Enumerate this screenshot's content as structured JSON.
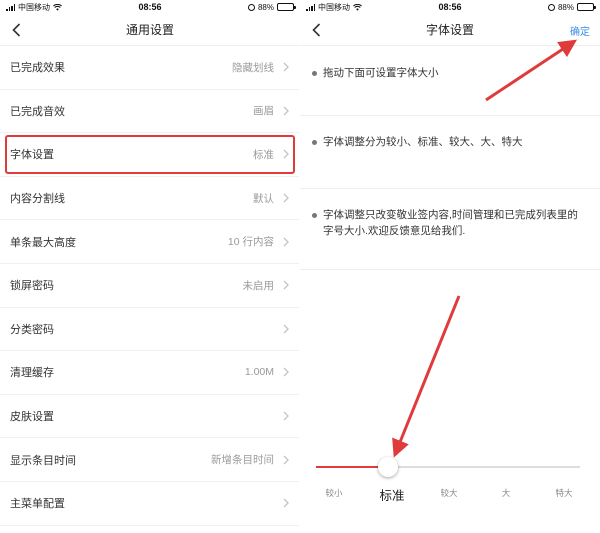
{
  "status_bar": {
    "carrier": "中国移动",
    "time": "08:56",
    "battery": "88%",
    "battery_level": 0.88
  },
  "left_screen": {
    "title": "通用设置",
    "rows": [
      {
        "label": "已完成效果",
        "value": "隐藏划线"
      },
      {
        "label": "已完成音效",
        "value": "画眉"
      },
      {
        "label": "字体设置",
        "value": "标准",
        "highlight": true
      },
      {
        "label": "内容分割线",
        "value": "默认"
      },
      {
        "label": "单条最大高度",
        "value": "10 行内容"
      },
      {
        "label": "锁屏密码",
        "value": "未启用"
      },
      {
        "label": "分类密码",
        "value": ""
      },
      {
        "label": "清理缓存",
        "value": "1.00M"
      },
      {
        "label": "皮肤设置",
        "value": ""
      },
      {
        "label": "显示条目时间",
        "value": "新增条目时间"
      },
      {
        "label": "主菜单配置",
        "value": ""
      }
    ]
  },
  "right_screen": {
    "title": "字体设置",
    "confirm_label": "确定",
    "tips": [
      "拖动下面可设置字体大小",
      "字体调整分为较小、标准、较大、大、特大",
      "字体调整只改变敬业签内容,时间管理和已完成列表里的字号大小.欢迎反馈意见给我们."
    ],
    "slider": {
      "options": [
        "较小",
        "标准",
        "较大",
        "大",
        "特大"
      ],
      "selected_index": 1
    }
  },
  "colors": {
    "accent_red": "#e03b3b",
    "link_blue": "#3a8ee6",
    "value_gray": "#9a9a9a"
  },
  "icons": [
    "back-chevron-icon",
    "chevron-right-icon",
    "wifi-icon",
    "signal-icon",
    "alarm-icon",
    "battery-icon"
  ]
}
